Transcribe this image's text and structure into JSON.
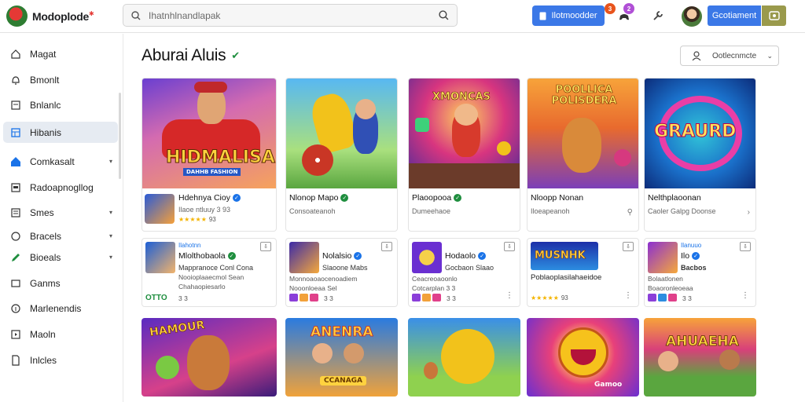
{
  "app": {
    "name": "Modoplode",
    "brand_mark": "✱"
  },
  "search": {
    "placeholder": "Ihatnhlnandlapak"
  },
  "header": {
    "primary_button": "Ilotmoodder",
    "notif_count_a": "3",
    "notif_count_b": "2",
    "account_button": "Gcotiament"
  },
  "sidebar": {
    "items": [
      {
        "label": "Magat",
        "icon": "home-outline-icon"
      },
      {
        "label": "Bmonlt",
        "icon": "bell-icon"
      },
      {
        "label": "Bnlanlc",
        "icon": "list-icon"
      },
      {
        "label": "Hibanis",
        "icon": "grid-icon"
      },
      {
        "label": "Comkasalt",
        "icon": "home-icon"
      },
      {
        "label": "Radoapnogllog",
        "icon": "square-icon"
      },
      {
        "label": "Smes",
        "icon": "chat-icon"
      },
      {
        "label": "Bracels",
        "icon": "circle-icon"
      },
      {
        "label": "Bioeals",
        "icon": "pencil-icon"
      },
      {
        "label": "Ganms",
        "icon": "message-icon"
      },
      {
        "label": "Marlenendis",
        "icon": "info-icon"
      },
      {
        "label": "Maoln",
        "icon": "play-icon"
      },
      {
        "label": "Inlcles",
        "icon": "document-icon"
      }
    ]
  },
  "page": {
    "title": "Aburai Aluis",
    "sort_label": "Ootlecnmcte"
  },
  "row1": [
    {
      "art_text": "HIDMALISA",
      "art_sub": "DAHHB FASHION",
      "name": "Hdehnya Cioy",
      "sub": "Ilaoe ntluuy 3 93",
      "rating": "93",
      "verified": "blue"
    },
    {
      "art_text": "",
      "name": "Nlonop Mapo",
      "sub": "Consoateanoh",
      "verified": "green"
    },
    {
      "art_text": "XMONCAS",
      "name": "Plaoopooa",
      "sub": "Dumeehaoe",
      "verified": "green"
    },
    {
      "art_text": "POOLLICA POLISDERA",
      "name": "Nloopp Nonan",
      "sub": "Iloeapeanoh",
      "verified": ""
    },
    {
      "art_text": "GRAURD",
      "name": "Nelthplaoonan",
      "sub": "Caoler Galpg Doonse",
      "verified": ""
    }
  ],
  "row2": [
    {
      "t1": "Ilahotnn",
      "t2": "Mlolthobaola",
      "t3": "Mappranoce Conl Cona",
      "t4": "Nooioplaaecmol Sean",
      "t5": "Chahaopiesarlo",
      "badge": "OTTO",
      "rating": "3 3",
      "verified": "green"
    },
    {
      "t1": "",
      "t2": "Nolalsio",
      "t3": "Slaoone Mabs",
      "t4": "Monnoaoaocenoadiem",
      "t5": "Nooonloeaa Sel",
      "rating": "3 3",
      "verified": "blue"
    },
    {
      "t1": "",
      "t2": "Hodaolo",
      "t3": "Gocbaon Slaao",
      "t4": "Ceacreoaoonlo",
      "t5": "Cotcarplan 3 3",
      "rating": "3 3",
      "verified": "blue"
    },
    {
      "t1": "",
      "t2": "",
      "t3": "Poblaoplasilahaeidoe",
      "art_text": "MUSNHK",
      "rating": "93",
      "verified": ""
    },
    {
      "t1": "Ilanuuo",
      "t2": "Ilo",
      "t3": "Bacbos",
      "t4": "Bolaatlonen",
      "t5": "Boaoronleoeaa",
      "rating": "3 3",
      "verified": "blue"
    }
  ],
  "row3": [
    {
      "art_text": "HAMOUR"
    },
    {
      "art_text": "ANENRA",
      "art_sub": "CCANAGA"
    },
    {
      "art_text": ""
    },
    {
      "art_text": "Gamoo"
    },
    {
      "art_text": "AHUAEHA"
    }
  ]
}
